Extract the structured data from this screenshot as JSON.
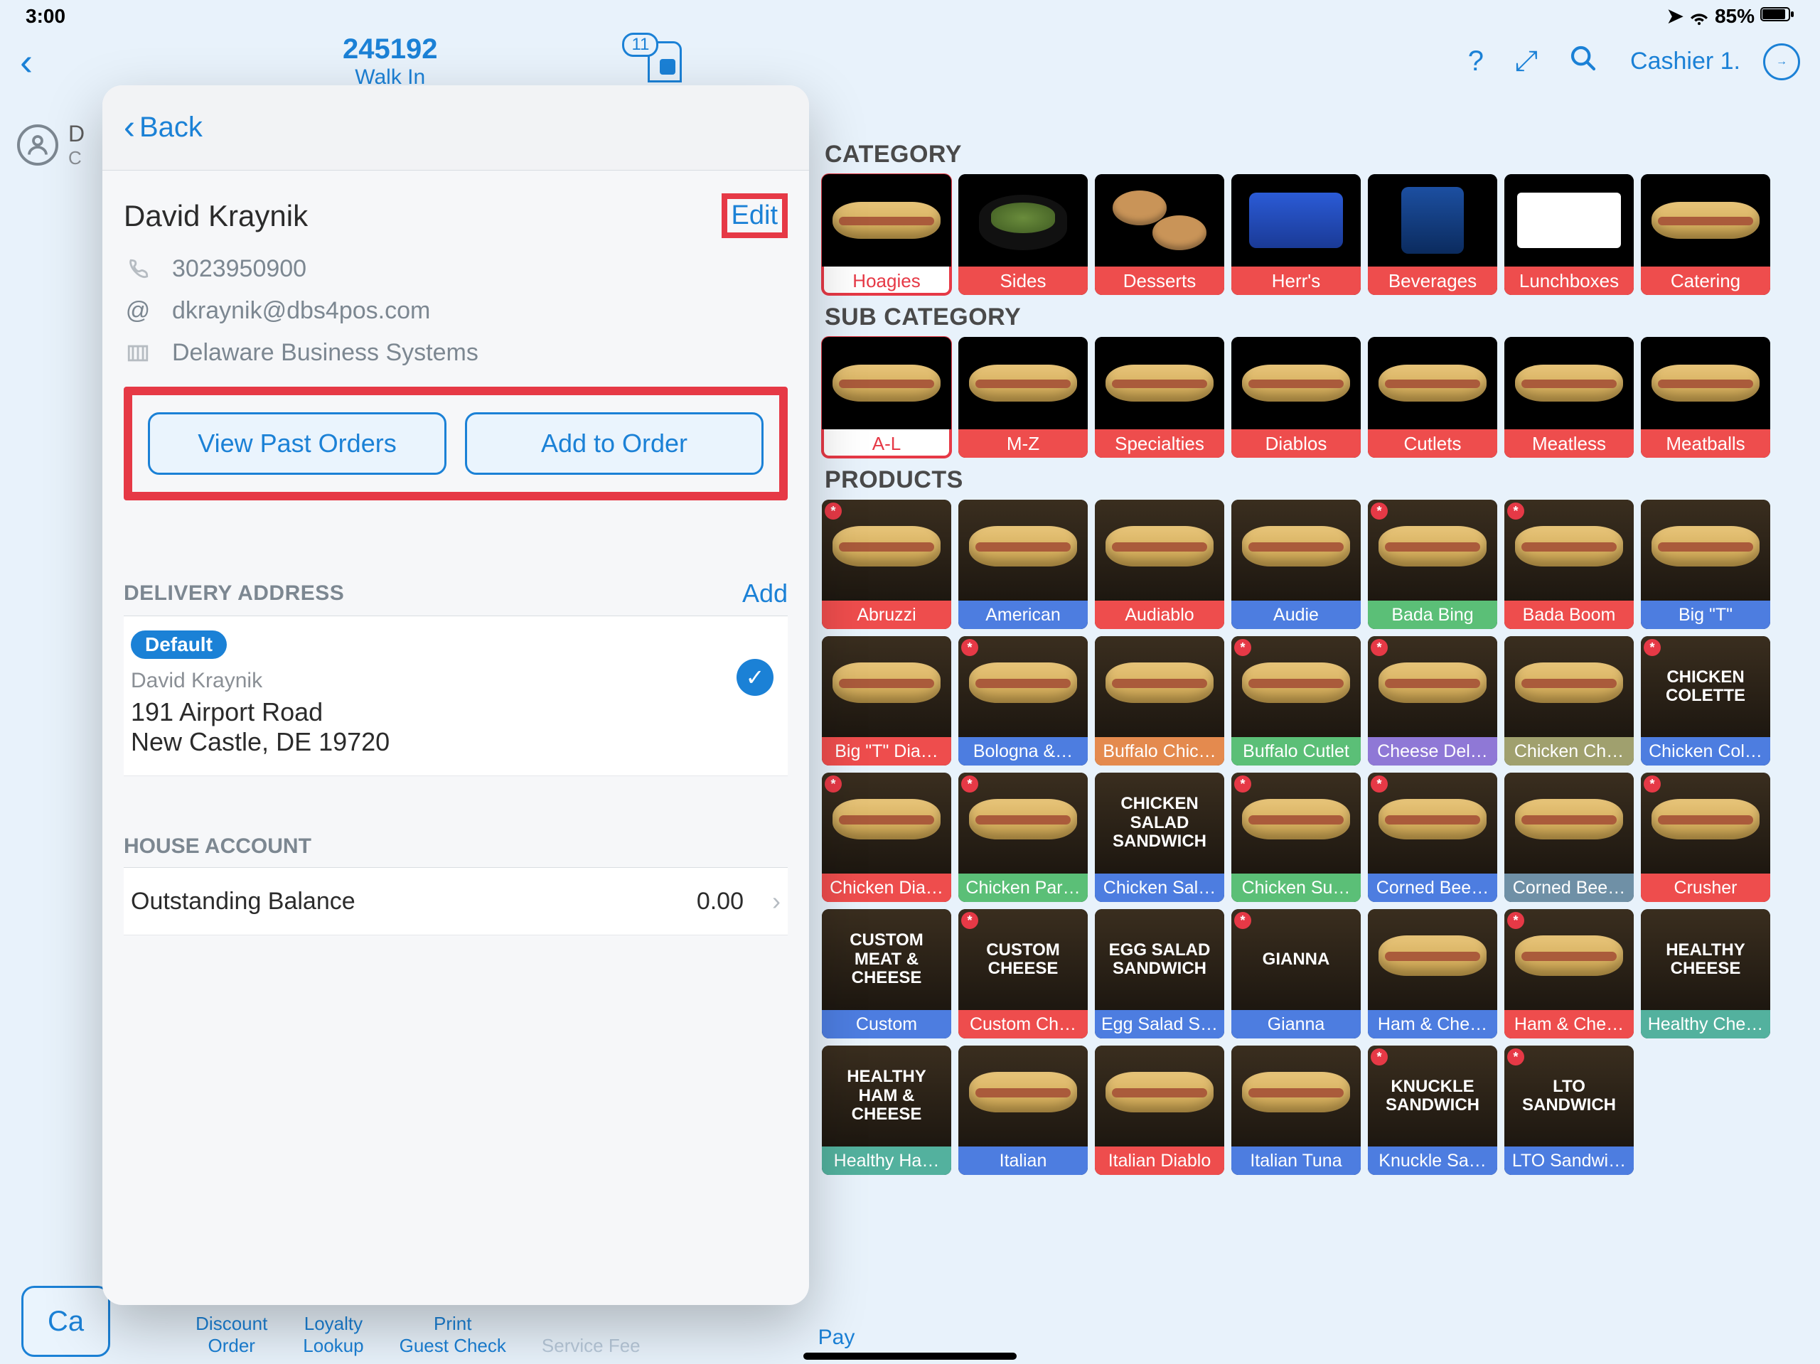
{
  "status": {
    "time": "3:00",
    "battery": "85%"
  },
  "header": {
    "order_number": "245192",
    "order_type": "Walk In",
    "doc_count": "11",
    "cashier": "Cashier 1."
  },
  "popover": {
    "back": "Back",
    "edit": "Edit",
    "customer_name": "David Kraynik",
    "phone": "3023950900",
    "email": "dkraynik@dbs4pos.com",
    "company": "Delaware Business Systems",
    "view_past": "View Past Orders",
    "add_to_order": "Add to Order",
    "delivery_title": "DELIVERY ADDRESS",
    "add": "Add",
    "default_pill": "Default",
    "addr_name": "David Kraynik",
    "addr_line1": "191 Airport Road",
    "addr_line2": "New Castle, DE 19720",
    "house_title": "HOUSE ACCOUNT",
    "balance_label": "Outstanding Balance",
    "balance_value": "0.00"
  },
  "categories": {
    "title": "CATEGORY",
    "items": [
      {
        "label": "Hoagies",
        "style": "lbl-red",
        "selected": true,
        "img": "sandwich"
      },
      {
        "label": "Sides",
        "style": "lbl-red",
        "img": "bowl"
      },
      {
        "label": "Desserts",
        "style": "lbl-red",
        "img": "cookies"
      },
      {
        "label": "Herr's",
        "style": "lbl-red",
        "img": "chips"
      },
      {
        "label": "Beverages",
        "style": "lbl-red",
        "img": "bottles"
      },
      {
        "label": "Lunchboxes",
        "style": "lbl-red",
        "img": "boxed"
      },
      {
        "label": "Catering",
        "style": "lbl-red",
        "img": "sandwich"
      }
    ]
  },
  "subcategories": {
    "title": "SUB CATEGORY",
    "items": [
      {
        "label": "A-L",
        "style": "lbl-red",
        "selected": true,
        "img": "sandwich"
      },
      {
        "label": "M-Z",
        "style": "lbl-red",
        "img": "sandwich"
      },
      {
        "label": "Specialties",
        "style": "lbl-red",
        "img": "sandwich"
      },
      {
        "label": "Diablos",
        "style": "lbl-red",
        "img": "sandwich"
      },
      {
        "label": "Cutlets",
        "style": "lbl-red",
        "img": "sandwich"
      },
      {
        "label": "Meatless",
        "style": "lbl-red",
        "img": "sandwich"
      },
      {
        "label": "Meatballs",
        "style": "lbl-red",
        "img": "sandwich"
      }
    ]
  },
  "products": {
    "title": "PRODUCTS",
    "items": [
      {
        "label": "Abruzzi",
        "style": "lbl-red",
        "star": true,
        "img": "sandwich"
      },
      {
        "label": "American",
        "style": "lbl-blue",
        "img": "sandwich"
      },
      {
        "label": "Audiablo",
        "style": "lbl-red",
        "img": "sandwich"
      },
      {
        "label": "Audie",
        "style": "lbl-blue",
        "img": "sandwich"
      },
      {
        "label": "Bada Bing",
        "style": "lbl-green",
        "star": true,
        "img": "sandwich"
      },
      {
        "label": "Bada Boom",
        "style": "lbl-red",
        "star": true,
        "img": "sandwich"
      },
      {
        "label": "Big \"T\"",
        "style": "lbl-blue",
        "img": "sandwich"
      },
      {
        "label": "Big \"T\" Dia…",
        "style": "lbl-red",
        "img": "sandwich"
      },
      {
        "label": "Bologna &…",
        "style": "lbl-blue",
        "star": true,
        "img": "sandwich"
      },
      {
        "label": "Buffalo Chic…",
        "style": "lbl-orange",
        "img": "sandwich"
      },
      {
        "label": "Buffalo Cutlet",
        "style": "lbl-green",
        "star": true,
        "img": "sandwich"
      },
      {
        "label": "Cheese Del…",
        "style": "lbl-purple",
        "star": true,
        "img": "sandwich"
      },
      {
        "label": "Chicken Ch…",
        "style": "lbl-olive",
        "img": "sandwich"
      },
      {
        "label": "Chicken Col…",
        "style": "lbl-blue",
        "star": true,
        "img": "text",
        "text": "CHICKEN\nCOLETTE"
      },
      {
        "label": "Chicken Dia…",
        "style": "lbl-red",
        "star": true,
        "img": "sandwich"
      },
      {
        "label": "Chicken Par…",
        "style": "lbl-green",
        "star": true,
        "img": "sandwich"
      },
      {
        "label": "Chicken Sal…",
        "style": "lbl-blue",
        "img": "text",
        "text": "CHICKEN\nSALAD\nSANDWICH"
      },
      {
        "label": "Chicken Su…",
        "style": "lbl-green",
        "star": true,
        "img": "sandwich"
      },
      {
        "label": "Corned Bee…",
        "style": "lbl-blue",
        "star": true,
        "img": "sandwich"
      },
      {
        "label": "Corned Bee…",
        "style": "lbl-grayblue",
        "img": "sandwich"
      },
      {
        "label": "Crusher",
        "style": "lbl-red",
        "star": true,
        "img": "sandwich"
      },
      {
        "label": "Custom",
        "style": "lbl-blue",
        "img": "text",
        "text": "CUSTOM\nMEAT &\nCHEESE"
      },
      {
        "label": "Custom Ch…",
        "style": "lbl-red",
        "star": true,
        "img": "text",
        "text": "CUSTOM\nCHEESE"
      },
      {
        "label": "Egg Salad S…",
        "style": "lbl-blue",
        "img": "text",
        "text": "EGG SALAD\nSANDWICH"
      },
      {
        "label": "Gianna",
        "style": "lbl-blue",
        "star": true,
        "img": "text",
        "text": "GIANNA"
      },
      {
        "label": "Ham & Che…",
        "style": "lbl-blue",
        "img": "sandwich"
      },
      {
        "label": "Ham & Che…",
        "style": "lbl-red",
        "star": true,
        "img": "sandwich"
      },
      {
        "label": "Healthy Che…",
        "style": "lbl-teal",
        "img": "text",
        "text": "HEALTHY\nCHEESE"
      },
      {
        "label": "Healthy Ha…",
        "style": "lbl-teal",
        "img": "text",
        "text": "HEALTHY\nHAM &\nCHEESE"
      },
      {
        "label": "Italian",
        "style": "lbl-blue",
        "img": "sandwich"
      },
      {
        "label": "Italian Diablo",
        "style": "lbl-red",
        "img": "sandwich"
      },
      {
        "label": "Italian Tuna",
        "style": "lbl-blue",
        "img": "sandwich"
      },
      {
        "label": "Knuckle Sa…",
        "style": "lbl-blue",
        "star": true,
        "img": "text",
        "text": "KNUCKLE\nSANDWICH"
      },
      {
        "label": "LTO Sandwi…",
        "style": "lbl-blue",
        "star": true,
        "img": "text",
        "text": "LTO\nSANDWICH"
      }
    ]
  },
  "bottom": {
    "cancel": "Ca",
    "discount": "Discount\nOrder",
    "loyalty": "Loyalty\nLookup",
    "print": "Print\nGuest Check",
    "service": "Service Fee",
    "pay": "Pay"
  }
}
